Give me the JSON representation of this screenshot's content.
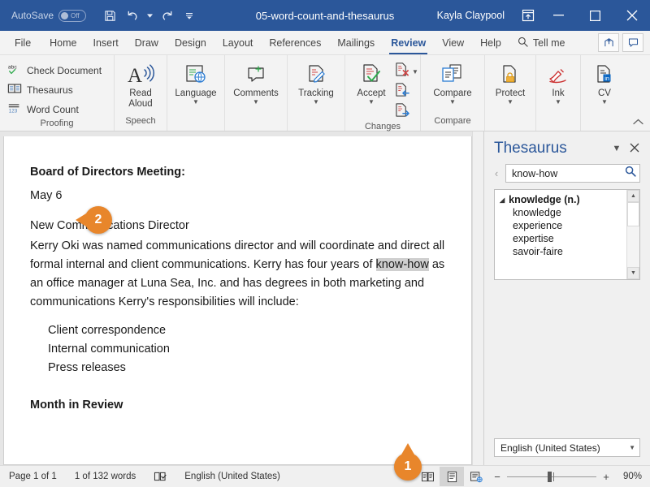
{
  "titlebar": {
    "autosave_label": "AutoSave",
    "autosave_state": "Off",
    "document_title": "05-word-count-and-thesaurus",
    "user_name": "Kayla Claypool",
    "quick_access": [
      {
        "name": "save-icon",
        "label": "Save"
      },
      {
        "name": "undo-icon",
        "label": "Undo"
      },
      {
        "name": "redo-icon",
        "label": "Redo"
      },
      {
        "name": "customize-qat-icon",
        "label": "Customize Quick Access Toolbar"
      }
    ],
    "window_buttons": [
      {
        "name": "ribbon-display-options-icon",
        "label": "Ribbon Display Options"
      },
      {
        "name": "minimize-icon",
        "label": "Minimize"
      },
      {
        "name": "maximize-icon",
        "label": "Restore Down"
      },
      {
        "name": "close-icon",
        "label": "Close"
      }
    ]
  },
  "tabs": {
    "items": [
      {
        "label": "File"
      },
      {
        "label": "Home"
      },
      {
        "label": "Insert"
      },
      {
        "label": "Draw"
      },
      {
        "label": "Design"
      },
      {
        "label": "Layout"
      },
      {
        "label": "References"
      },
      {
        "label": "Mailings"
      },
      {
        "label": "Review"
      },
      {
        "label": "View"
      },
      {
        "label": "Help"
      }
    ],
    "active": "Review",
    "tell_me": "Tell me",
    "share_label": "Share",
    "comments_label": "Comments"
  },
  "ribbon": {
    "groups": [
      {
        "name": "Proofing",
        "commands": [
          {
            "label": "Check Document",
            "icon": "abc-check-icon"
          },
          {
            "label": "Thesaurus",
            "icon": "book-icon"
          },
          {
            "label": "Word Count",
            "icon": "word-count-icon"
          }
        ]
      },
      {
        "name": "Speech",
        "commands": [
          {
            "label": "Read Aloud",
            "icon": "read-aloud-icon"
          }
        ]
      },
      {
        "name": "",
        "commands": [
          {
            "label": "Language",
            "icon": "language-icon"
          }
        ]
      },
      {
        "name": "",
        "commands": [
          {
            "label": "Comments",
            "icon": "comment-icon"
          }
        ]
      },
      {
        "name": "",
        "commands": [
          {
            "label": "Tracking",
            "icon": "tracking-icon"
          }
        ]
      },
      {
        "name": "Changes",
        "commands": [
          {
            "label": "Accept",
            "icon": "accept-icon"
          },
          {
            "label": "Reject",
            "icon": "reject-icon"
          },
          {
            "label": "Previous",
            "icon": "previous-change-icon"
          },
          {
            "label": "Next",
            "icon": "next-change-icon"
          }
        ]
      },
      {
        "name": "Compare",
        "commands": [
          {
            "label": "Compare",
            "icon": "compare-icon"
          }
        ]
      },
      {
        "name": "",
        "commands": [
          {
            "label": "Protect",
            "icon": "protect-icon"
          }
        ]
      },
      {
        "name": "",
        "commands": [
          {
            "label": "Ink",
            "icon": "ink-icon"
          }
        ]
      },
      {
        "name": "",
        "commands": [
          {
            "label": "CV",
            "icon": "cv-icon"
          }
        ]
      }
    ],
    "labels": {
      "proofing": "Proofing",
      "speech": "Speech",
      "changes": "Changes",
      "compare_group": "Compare",
      "check_document": "Check Document",
      "thesaurus": "Thesaurus",
      "word_count": "Word Count",
      "read_aloud_1": "Read",
      "read_aloud_2": "Aloud",
      "language": "Language",
      "comments": "Comments",
      "tracking": "Tracking",
      "accept": "Accept",
      "compare": "Compare",
      "protect": "Protect",
      "ink": "Ink",
      "cv": "CV"
    }
  },
  "document": {
    "heading": "Board of Directors Meeting:",
    "date": "May 6",
    "subheading": "New Communications Director",
    "paragraph_before_selection": "Kerry Oki was named communications director and will coordinate and direct all formal internal and client communications. Kerry has four years of ",
    "selected_word": "know-how",
    "paragraph_after_selection": " as an office manager at Luna Sea, Inc. and has degrees in both marketing and communications Kerry's responsibilities will include:",
    "list_items": [
      "Client correspondence",
      "Internal communication",
      "Press releases"
    ],
    "heading2": "Month in Review"
  },
  "thesaurus_pane": {
    "title": "Thesaurus",
    "search_value": "know-how",
    "search_placeholder": "Search",
    "group_label": "knowledge (n.)",
    "synonyms": [
      "knowledge",
      "experience",
      "expertise",
      "savoir-faire"
    ],
    "language": "English (United States)"
  },
  "statusbar": {
    "page": "Page 1 of 1",
    "word_count": "1 of 132 words",
    "proofing_icon_label": "Proofing errors",
    "language": "English (United States)",
    "views": [
      {
        "name": "read-mode-icon",
        "label": "Read Mode",
        "active": false
      },
      {
        "name": "print-layout-icon",
        "label": "Print Layout",
        "active": true
      },
      {
        "name": "web-layout-icon",
        "label": "Web Layout",
        "active": false
      }
    ],
    "zoom_out": "−",
    "zoom_in": "+",
    "zoom_level": "90%"
  },
  "callouts": [
    {
      "number": "1",
      "target": "selected-word"
    },
    {
      "number": "2",
      "target": "thesaurus-button"
    }
  ],
  "colors": {
    "titlebar": "#2b579a",
    "accent": "#2b579a",
    "callout": "#e8862b",
    "ribbon_bg": "#f3f3f3",
    "selection": "#cfcfcf"
  }
}
